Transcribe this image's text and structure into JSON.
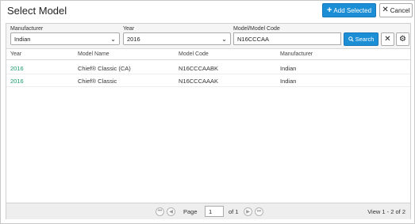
{
  "dialog": {
    "title": "Select Model",
    "add_selected_label": "Add Selected",
    "cancel_label": "Cancel"
  },
  "filters": {
    "manufacturer_label": "Manufacturer",
    "manufacturer_value": "Indian",
    "year_label": "Year",
    "year_value": "2016",
    "model_code_label": "Model/Model Code",
    "model_code_value": "N16CCCAA",
    "search_label": "Search"
  },
  "table": {
    "headers": [
      "Year",
      "Model Name",
      "Model Code",
      "Manufacturer"
    ],
    "rows": [
      [
        "2016",
        "Chief® Classic (CA)",
        "N16CCCAABK",
        "Indian"
      ],
      [
        "2016",
        "Chief® Classic",
        "N16CCCAAAK",
        "Indian"
      ]
    ]
  },
  "pagination": {
    "page_label": "Page",
    "page_value": "1",
    "of_label": "of 1",
    "view_text": "View 1 - 2 of 2"
  },
  "icons": {
    "plus": "plus-icon",
    "close": "close-icon",
    "search": "search-icon",
    "gear": "gear-icon",
    "first": "first-page-icon",
    "prev": "prev-page-icon",
    "next": "next-page-icon",
    "last": "last-page-icon"
  },
  "colors": {
    "accent": "#1c8ed6",
    "year_link": "#1a9a6a"
  }
}
